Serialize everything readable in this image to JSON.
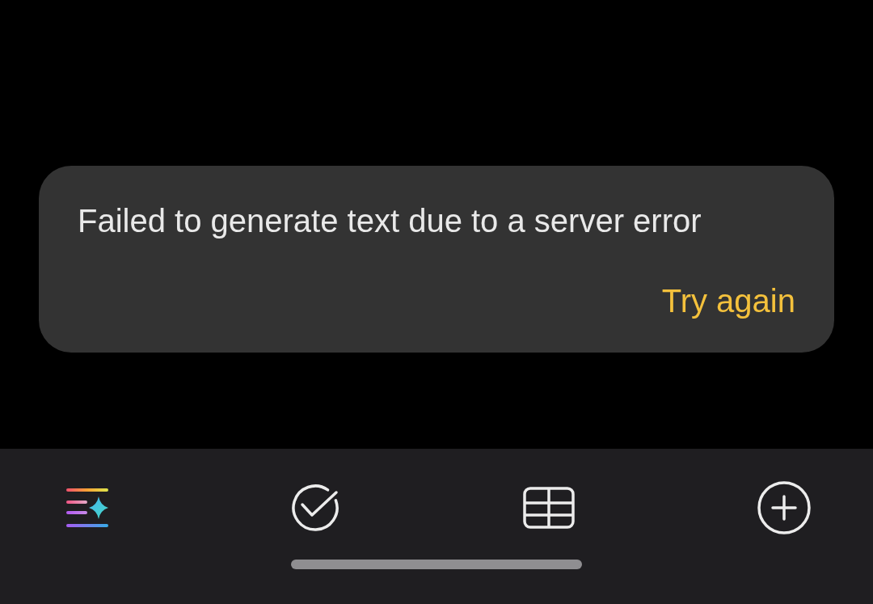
{
  "error_card": {
    "message": "Failed to generate text due to a server error",
    "action": "Try again"
  }
}
